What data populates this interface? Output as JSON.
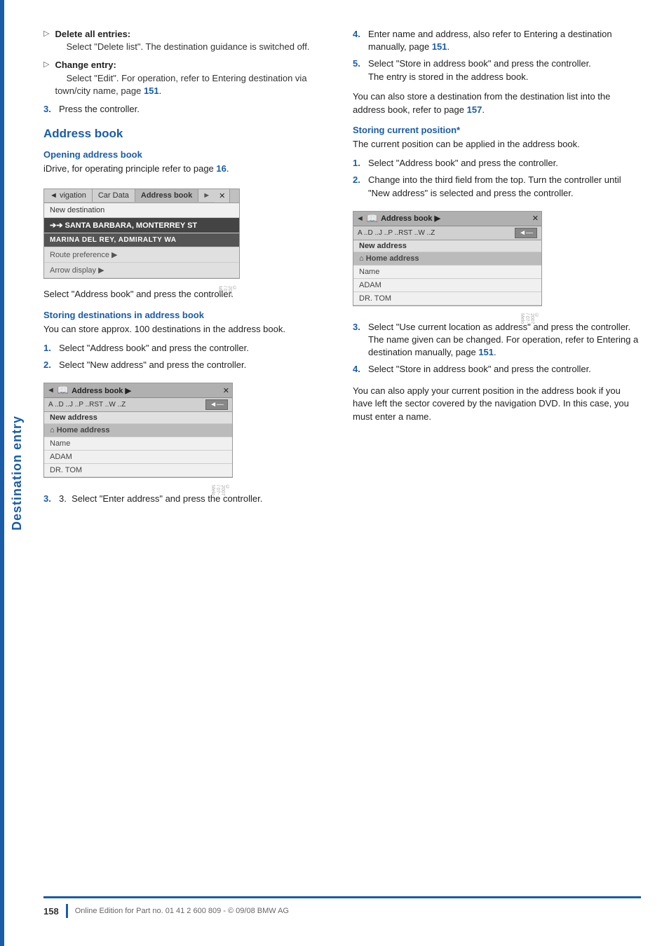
{
  "side_label": "Destination entry",
  "left_column": {
    "bullets": [
      {
        "arrow": "▷",
        "title": "Delete all entries:",
        "body": "Select \"Delete list\". The destination guidance is switched off."
      },
      {
        "arrow": "▷",
        "title": "Change entry:",
        "body": "Select \"Edit\". For operation, refer to Entering destination via town/city name, page 151."
      }
    ],
    "step3": "3.  Press the controller.",
    "address_book_title": "Address book",
    "opening_title": "Opening address book",
    "opening_text": "iDrive, for operating principle refer to page 16.",
    "nav_ui": {
      "tabs": [
        "◄ vigation",
        "Car Data",
        "Address book",
        "►",
        "✕"
      ],
      "rows": [
        {
          "text": "New destination",
          "style": "normal"
        },
        {
          "text": "➔➔ SANTA BARBARA, MONTERREY ST",
          "style": "highlighted"
        },
        {
          "text": "MARINA DEL REY, ADMIRALTY WA",
          "style": "bold-dark"
        },
        {
          "text": "Route preference ▶",
          "style": "light"
        },
        {
          "text": "Arrow display ▶",
          "style": "light"
        }
      ]
    },
    "select_instruction": "Select \"Address book\" and press the controller.",
    "storing_title": "Storing destinations in address book",
    "storing_intro": "You can store approx. 100 destinations in the address book.",
    "storing_steps": [
      "Select \"Address book\" and press the controller.",
      "Select \"New address\" and press the controller."
    ],
    "addr_ui": {
      "header_left_arrow": "◄",
      "header_icon": "📖",
      "header_title": "Address book ▶",
      "header_right": "✕",
      "alpha_row": "A ..D ..J ..P ..RST ..W ..Z",
      "enter_btn": "◄—",
      "section_label": "New address",
      "items": [
        {
          "text": "⌂ Home address",
          "icon": true
        },
        {
          "text": "Name"
        },
        {
          "text": "ADAM"
        },
        {
          "text": "DR. TOM"
        }
      ]
    },
    "step3_addr": "3.  Select \"Enter address\" and press the controller."
  },
  "right_column": {
    "steps_4_5": [
      "Enter name and address, also refer to Entering a destination manually, page 151.",
      "Select \"Store in address book\" and press the controller.\nThe entry is stored in the address book."
    ],
    "also_store_text": "You can also store a destination from the destination list into the address book, refer to page 157.",
    "storing_current_title": "Storing current position*",
    "storing_current_intro": "The current position can be applied in the address book.",
    "current_steps": [
      "Select \"Address book\" and press the controller.",
      "Change into the third field from the top. Turn the controller until \"New address\" is selected and press the controller."
    ],
    "addr_ui2": {
      "header_left_arrow": "◄",
      "header_icon": "📖",
      "header_title": "Address book ▶",
      "header_right": "✕",
      "alpha_row": "A ..D ..J ..P ..RST ..W ..Z",
      "enter_btn": "◄—",
      "section_label": "New address",
      "items": [
        {
          "text": "⌂ Home address",
          "icon": true
        },
        {
          "text": "Name"
        },
        {
          "text": "ADAM"
        },
        {
          "text": "DR. TOM"
        }
      ]
    },
    "current_steps_3_4": [
      "Select \"Use current location as address\" and press the controller.\nThe name given can be changed. For operation, refer to Entering a destination manually, page 151.",
      "Select \"Store in address book\" and press the controller."
    ],
    "also_apply_text": "You can also apply your current position in the address book if you have left the sector covered by the navigation DVD. In this case, you must enter a name."
  },
  "footer": {
    "page_num": "158",
    "divider": true,
    "text": "Online Edition for Part no. 01 41 2 600 809 - © 09/08 BMW AG"
  },
  "page_refs": {
    "ref16": "16",
    "ref151_1": "151",
    "ref151_2": "151",
    "ref151_3": "151",
    "ref157": "157"
  }
}
